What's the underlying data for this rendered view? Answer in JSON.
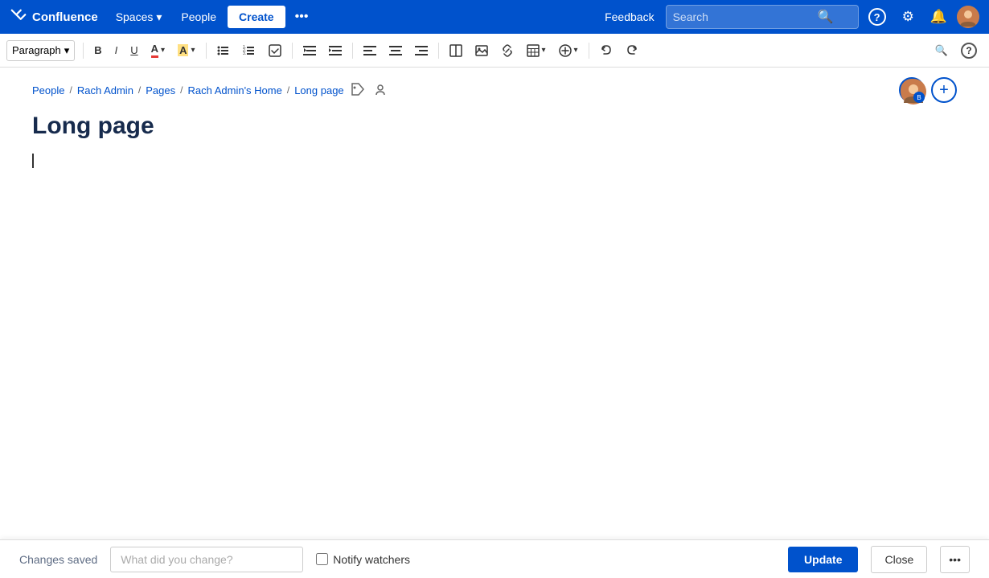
{
  "app": {
    "name": "Confluence",
    "logo_symbol": "✕"
  },
  "nav": {
    "spaces_label": "Spaces",
    "people_label": "People",
    "create_label": "Create",
    "more_icon": "•••",
    "feedback_label": "Feedback",
    "search_placeholder": "Search",
    "help_icon": "?",
    "settings_icon": "⚙",
    "notifications_icon": "🔔"
  },
  "toolbar": {
    "paragraph_label": "Paragraph",
    "bold": "B",
    "italic": "I",
    "underline": "U",
    "text_color": "A",
    "highlight": "A",
    "bullet_list": "☰",
    "numbered_list": "☰",
    "task": "☑",
    "indent_left": "⇤",
    "indent_right": "⇥",
    "align_left": "≡",
    "align_center": "≡",
    "align_right": "≡",
    "layout": "⊟",
    "image": "🖼",
    "link": "🔗",
    "table": "⊞",
    "insert_plus": "+",
    "undo": "↩",
    "redo": "↪",
    "search_icon": "🔍",
    "help_icon": "?"
  },
  "breadcrumb": {
    "items": [
      {
        "label": "People",
        "link": true
      },
      {
        "label": "Rach Admin",
        "link": true
      },
      {
        "label": "Pages",
        "link": true
      },
      {
        "label": "Rach Admin's Home",
        "link": true
      },
      {
        "label": "Long page",
        "link": true
      }
    ],
    "separator": "/"
  },
  "page": {
    "title": "Long page",
    "content": ""
  },
  "bottom_bar": {
    "changes_saved": "Changes saved",
    "change_placeholder": "What did you change?",
    "notify_watchers": "Notify watchers",
    "update_btn": "Update",
    "close_btn": "Close"
  }
}
